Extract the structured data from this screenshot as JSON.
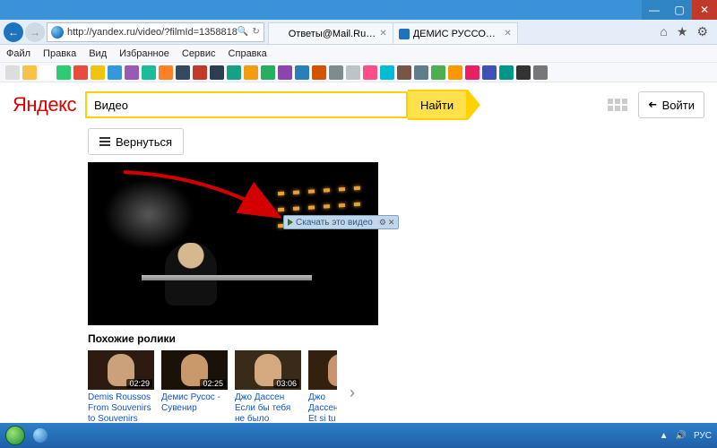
{
  "browser": {
    "url": "http://yandex.ru/video/?filmId=1358818",
    "url_ctrl_search": "🔍",
    "url_ctrl_refresh": "↻",
    "tabs": [
      {
        "label": "Ответы@Mail.Ru: Как ска...",
        "favicon": "#f39c12"
      },
      {
        "label": "ДЕМИС РУССОС - СУВ...",
        "favicon": "#1e73be"
      }
    ],
    "menus": [
      "Файл",
      "Правка",
      "Вид",
      "Избранное",
      "Сервис",
      "Справка"
    ],
    "ie_icons": {
      "home": "⌂",
      "star": "★",
      "gear": "⚙"
    },
    "ext_colors": [
      "#ddd",
      "#f7c24a",
      "#fff",
      "#2ecc71",
      "#e74c3c",
      "#f1c40f",
      "#3498db",
      "#9b59b6",
      "#1abc9c",
      "#ff7f27",
      "#34495e",
      "#c0392b",
      "#2c3e50",
      "#16a085",
      "#f39c12",
      "#27ae60",
      "#8e44ad",
      "#2980b9",
      "#d35400",
      "#7f8c8d",
      "#bdc3c7",
      "#ff4d88",
      "#00bcd4",
      "#795548",
      "#607d8b",
      "#4caf50",
      "#ff9800",
      "#e91e63",
      "#3f51b5",
      "#009688",
      "#333",
      "#777"
    ]
  },
  "yandex": {
    "logo": "Яндекс",
    "search_value": "Видео",
    "search_button": "Найти",
    "login": "Войти",
    "back": "Вернуться",
    "download_label": "Скачать это видео",
    "related_title": "Похожие ролики",
    "related": [
      {
        "duration": "02:29",
        "title": "Demis Roussos From Souvenirs to Souvenirs",
        "face": "#caa17a",
        "bg": "#2d1a10"
      },
      {
        "duration": "02:25",
        "title": "Демис Русос - Сувенир",
        "face": "#c9986b",
        "bg": "#1a1208"
      },
      {
        "duration": "03:06",
        "title": "Джо Дассен Если бы тебя не было",
        "face": "#d4a97f",
        "bg": "#3a2a18"
      },
      {
        "duration": "",
        "title": "Джо Дассен Et si tu n'ex",
        "face": "#c89470",
        "bg": "#33200f"
      }
    ]
  },
  "taskbar": {
    "lang": "РУС",
    "flag": "▲",
    "sound": "🔊"
  }
}
